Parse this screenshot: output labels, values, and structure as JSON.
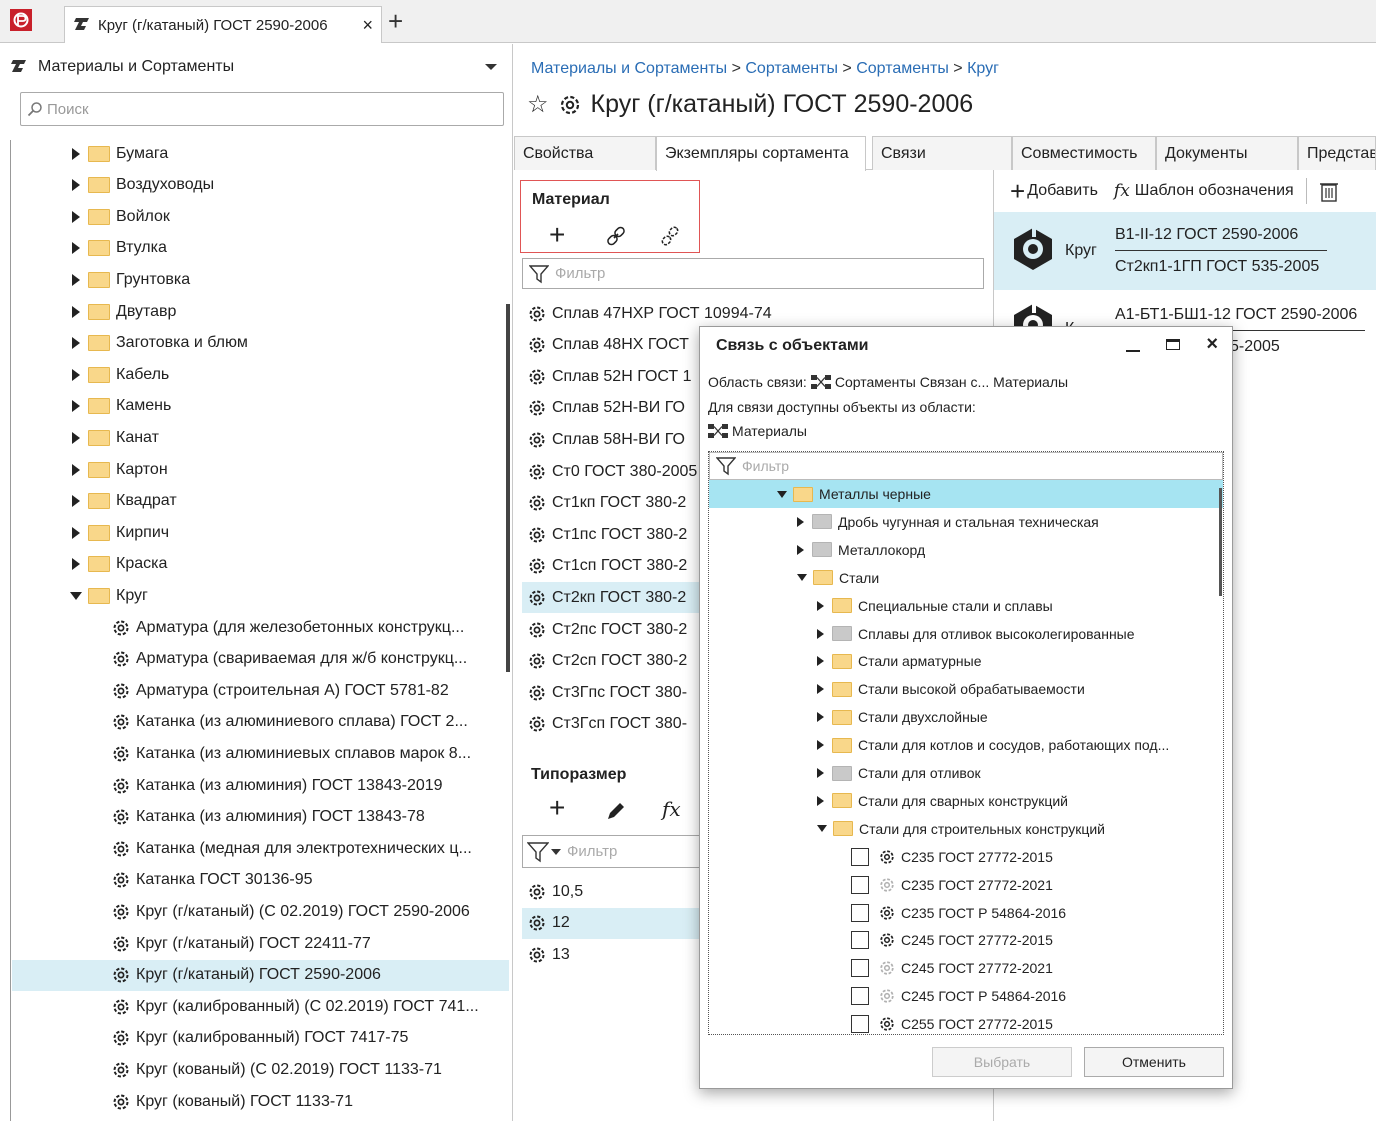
{
  "tab": {
    "title": "Круг (г/катаный) ГОСТ 2590-2006",
    "close": "×",
    "new": "+"
  },
  "left": {
    "header": "Материалы и Сортаменты",
    "search_placeholder": "Поиск",
    "folders": [
      "Бумага",
      "Воздуховоды",
      "Войлок",
      "Втулка",
      "Грунтовка",
      "Двутавр",
      "Заготовка и блюм",
      "Кабель",
      "Камень",
      "Канат",
      "Картон",
      "Квадрат",
      "Кирпич",
      "Краска"
    ],
    "open_folder": "Круг",
    "items": [
      "Арматура (для железобетонных конструкц...",
      "Арматура (свариваемая для ж/б конструкц...",
      "Арматура (строительная А) ГОСТ 5781-82",
      "Катанка (из алюминиевого сплава) ГОСТ 2...",
      "Катанка (из алюминиевых сплавов марок 8...",
      "Катанка (из алюминия) ГОСТ 13843-2019",
      "Катанка (из алюминия) ГОСТ 13843-78",
      "Катанка (медная для электротехнических ц...",
      "Катанка ГОСТ 30136-95",
      "Круг (г/катаный) (С 02.2019) ГОСТ 2590-2006",
      "Круг (г/катаный) ГОСТ 22411-77",
      "Круг (г/катаный) ГОСТ 2590-2006",
      "Круг (калиброванный) (С 02.2019) ГОСТ 741...",
      "Круг (калиброванный) ГОСТ 7417-75",
      "Круг (кованый) (С 02.2019) ГОСТ 1133-71",
      "Круг (кованый) ГОСТ 1133-71"
    ]
  },
  "breadcrumb": [
    "Материалы и Сортаменты",
    "Сортаменты",
    "Сортаменты",
    "Круг"
  ],
  "breadcrumb_sep": ">",
  "title": "Круг (г/катаный) ГОСТ 2590-2006",
  "tabs": [
    "Свойства",
    "Экземпляры сортамента",
    "Связи",
    "Совместимость",
    "Документы",
    "Представ"
  ],
  "material": {
    "title": "Материал",
    "filter_placeholder": "Фильтр",
    "items": [
      "Сплав 47НХР ГОСТ 10994-74",
      "Сплав 48НХ ГОСТ",
      "Сплав 52Н ГОСТ 1",
      "Сплав 52Н-ВИ ГО",
      "Сплав 58Н-ВИ ГО",
      "Ст0 ГОСТ 380-2005",
      "Ст1кп ГОСТ 380-2",
      "Ст1пс ГОСТ 380-2",
      "Ст1сп ГОСТ 380-2",
      "Ст2кп ГОСТ 380-2",
      "Ст2пс ГОСТ 380-2",
      "Ст2сп ГОСТ 380-2",
      "Ст3Гпс ГОСТ 380-",
      "Ст3Гсп ГОСТ 380-"
    ]
  },
  "tiporazmer": {
    "title": "Типоразмер",
    "filter_placeholder": "Фильтр",
    "items": [
      "10,5",
      "12",
      "13"
    ]
  },
  "right": {
    "add": "Добавить",
    "template": "Шаблон обозначения",
    "card1": {
      "label": "Круг",
      "line1": "В1-II-12 ГОСТ 2590-2006",
      "line2": "Ст2кп1-1ГП ГОСТ 535-2005"
    },
    "card2": {
      "label": "К",
      "line1": "А1-БТ1-БШ1-12 ГОСТ 2590-2006",
      "line2": "5-2005"
    }
  },
  "dialog": {
    "title": "Связь с объектами",
    "area_label": "Область связи:",
    "area_value": "Сортаменты Связан с... Материалы",
    "avail": "Для связи доступны объекты из области:",
    "materials": "Материалы",
    "filter_placeholder": "Фильтр",
    "tree": [
      {
        "text": "Металлы черные",
        "level": 0,
        "open": true,
        "folder": "yellow"
      },
      {
        "text": "Дробь чугунная и стальная техническая",
        "level": 1,
        "open": false,
        "folder": "grey"
      },
      {
        "text": "Металлокорд",
        "level": 1,
        "open": false,
        "folder": "grey"
      },
      {
        "text": "Стали",
        "level": 1,
        "open": true,
        "folder": "yellow"
      },
      {
        "text": "Специальные стали и сплавы",
        "level": 2,
        "open": false,
        "folder": "yellow"
      },
      {
        "text": "Сплавы для отливок высоколегированные",
        "level": 2,
        "open": false,
        "folder": "grey"
      },
      {
        "text": "Стали арматурные",
        "level": 2,
        "open": false,
        "folder": "yellow"
      },
      {
        "text": "Стали высокой обрабатываемости",
        "level": 2,
        "open": false,
        "folder": "yellow"
      },
      {
        "text": "Стали двухслойные",
        "level": 2,
        "open": false,
        "folder": "yellow"
      },
      {
        "text": "Стали для котлов и сосудов, работающих под...",
        "level": 2,
        "open": false,
        "folder": "yellow"
      },
      {
        "text": "Стали для отливок",
        "level": 2,
        "open": false,
        "folder": "grey"
      },
      {
        "text": "Стали для сварных конструкций",
        "level": 2,
        "open": false,
        "folder": "yellow"
      },
      {
        "text": "Стали для строительных конструкций",
        "level": 2,
        "open": true,
        "folder": "yellow"
      }
    ],
    "checks": [
      {
        "text": "С235 ГОСТ 27772-2015",
        "faded": false
      },
      {
        "text": "С235 ГОСТ 27772-2021",
        "faded": true
      },
      {
        "text": "С235 ГОСТ Р 54864-2016",
        "faded": false
      },
      {
        "text": "С245 ГОСТ 27772-2015",
        "faded": false
      },
      {
        "text": "С245 ГОСТ 27772-2021",
        "faded": true
      },
      {
        "text": "С245 ГОСТ Р 54864-2016",
        "faded": true
      },
      {
        "text": "С255 ГОСТ 27772-2015",
        "faded": false
      }
    ],
    "select": "Выбрать",
    "cancel": "Отменить"
  }
}
